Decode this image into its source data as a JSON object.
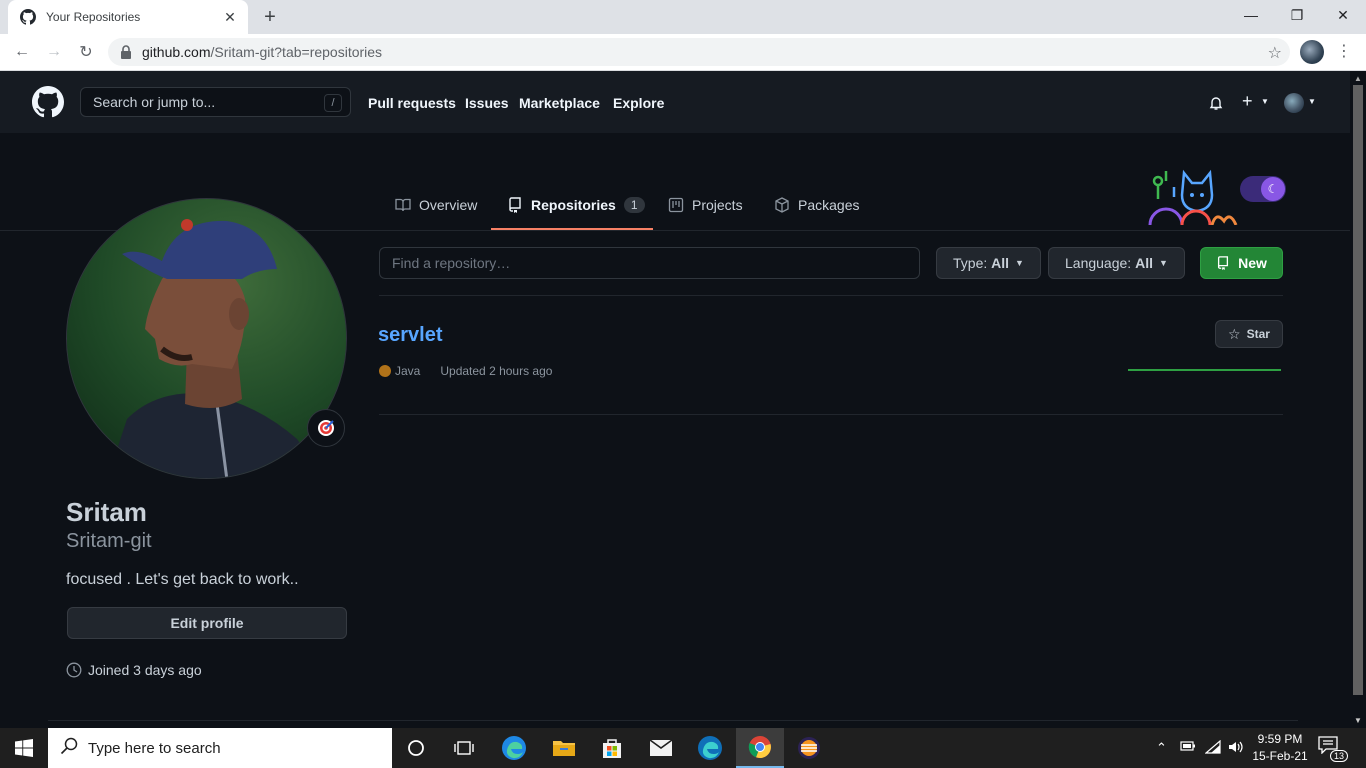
{
  "browser": {
    "tab_title": "Your Repositories",
    "url_host": "github.com",
    "url_path": "/Sritam-git?tab=repositories"
  },
  "header": {
    "search_placeholder": "Search or jump to...",
    "search_shortcut": "/",
    "nav": [
      "Pull requests",
      "Issues",
      "Marketplace",
      "Explore"
    ]
  },
  "profile_tabs": [
    {
      "label": "Overview"
    },
    {
      "label": "Repositories",
      "count": "1"
    },
    {
      "label": "Projects"
    },
    {
      "label": "Packages"
    }
  ],
  "sidebar": {
    "full_name": "Sritam",
    "login": "Sritam-git",
    "bio": "focused . Let's get back to work..",
    "edit_profile": "Edit profile",
    "joined": "Joined 3 days ago"
  },
  "repos_toolbar": {
    "find_placeholder": "Find a repository…",
    "type_label": "Type:",
    "type_value": "All",
    "language_label": "Language:",
    "language_value": "All",
    "new_label": "New"
  },
  "repos": [
    {
      "name": "servlet",
      "language": "Java",
      "language_color": "#b07219",
      "updated": "Updated 2 hours ago",
      "star_label": "Star"
    }
  ],
  "taskbar": {
    "search_placeholder": "Type here to search",
    "time": "9:59 PM",
    "date": "15-Feb-21",
    "notifications": "13"
  }
}
